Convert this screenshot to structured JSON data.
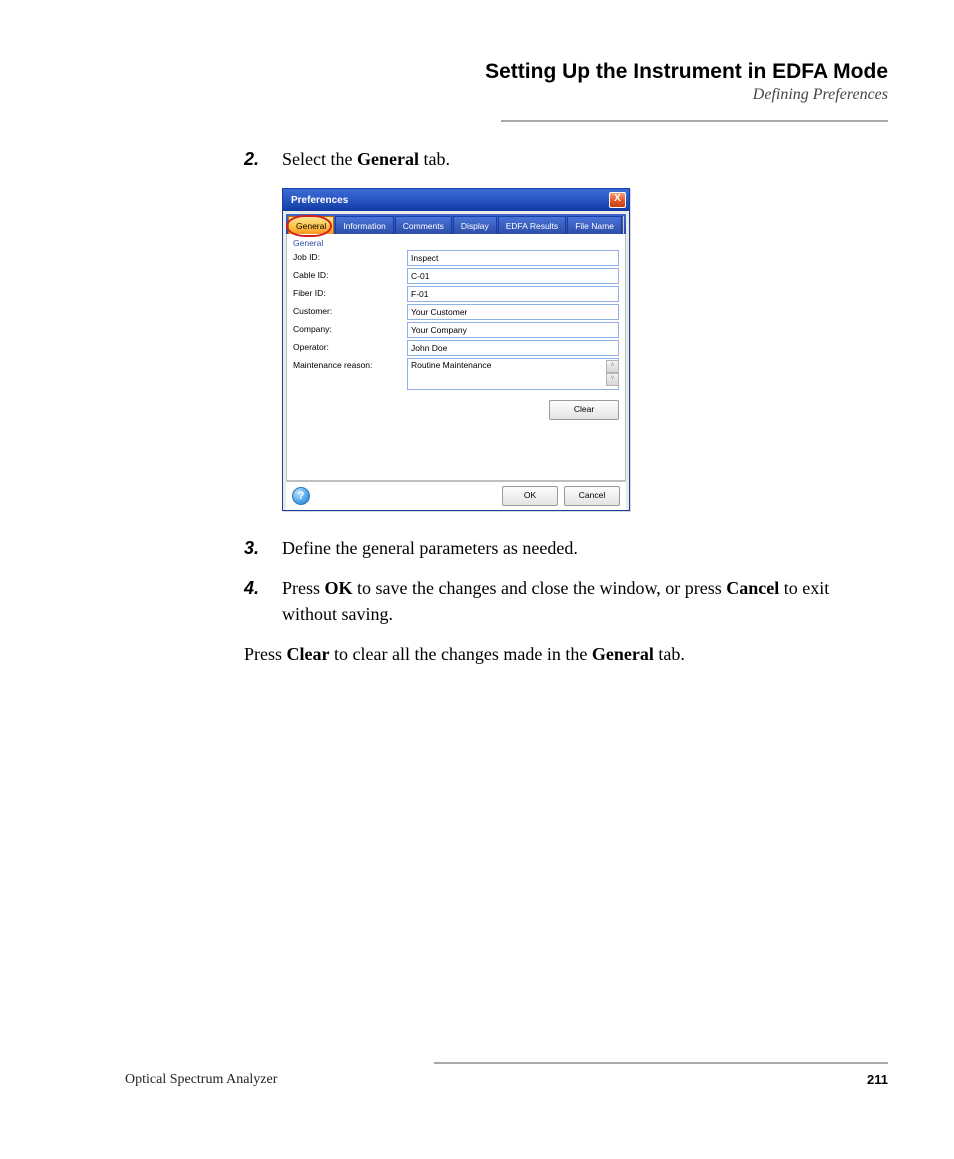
{
  "header": {
    "title": "Setting Up the Instrument in EDFA Mode",
    "subtitle": "Defining Preferences"
  },
  "steps": [
    {
      "num": "2.",
      "pre": "Select the ",
      "bold": "General",
      "post": " tab."
    },
    {
      "num": "3.",
      "pre": "Define the general parameters as needed.",
      "bold": "",
      "post": ""
    },
    {
      "num": "4.",
      "pre": "Press ",
      "bold": "OK",
      "post": " to save the changes and close the window, or press ",
      "bold2": "Cancel",
      "post2": " to exit without saving."
    }
  ],
  "paragraph": {
    "pre": "Press ",
    "bold1": "Clear",
    "mid": " to clear all the changes made in the ",
    "bold2": "General",
    "post": " tab."
  },
  "dialog": {
    "title": "Preferences",
    "close": "X",
    "tabs": [
      "General",
      "Information",
      "Comments",
      "Display",
      "EDFA Results",
      "File Name"
    ],
    "group": "General",
    "fields": {
      "job_id": {
        "label": "Job ID:",
        "value": "Inspect"
      },
      "cable_id": {
        "label": "Cable ID:",
        "value": "C-01"
      },
      "fiber_id": {
        "label": "Fiber ID:",
        "value": "F-01"
      },
      "customer": {
        "label": "Customer:",
        "value": "Your Customer"
      },
      "company": {
        "label": "Company:",
        "value": "Your Company"
      },
      "operator": {
        "label": "Operator:",
        "value": "John Doe"
      },
      "maint": {
        "label": "Maintenance reason:",
        "value": "Routine Maintenance"
      }
    },
    "buttons": {
      "clear": "Clear",
      "ok": "OK",
      "cancel": "Cancel",
      "help": "?"
    }
  },
  "footer": {
    "product": "Optical Spectrum Analyzer",
    "page": "211"
  }
}
